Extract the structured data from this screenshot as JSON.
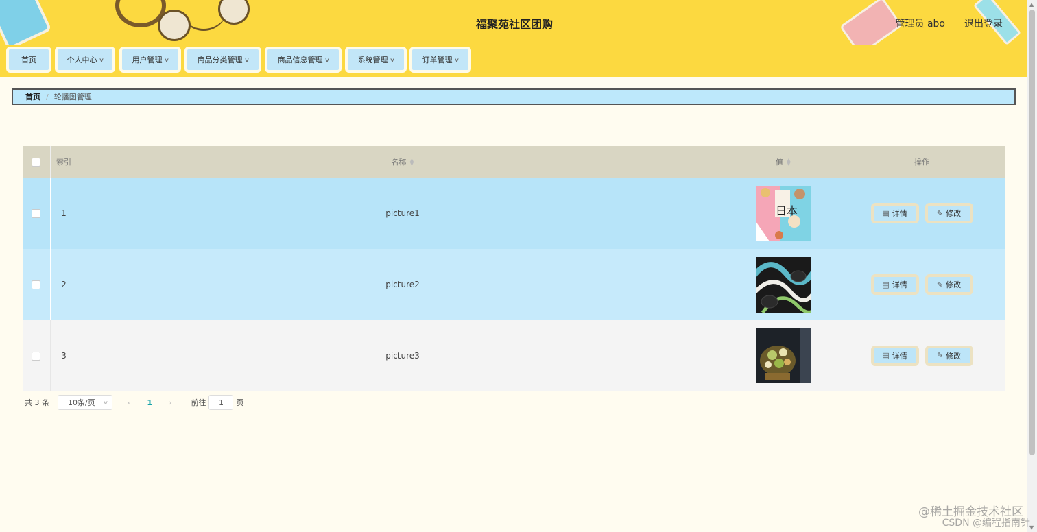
{
  "header": {
    "title": "福聚苑社区团购",
    "admin_label": "管理员 abo",
    "logout_label": "退出登录"
  },
  "nav": {
    "items": [
      {
        "label": "首页",
        "has_dropdown": false
      },
      {
        "label": "个人中心",
        "has_dropdown": true
      },
      {
        "label": "用户管理",
        "has_dropdown": true
      },
      {
        "label": "商品分类管理",
        "has_dropdown": true
      },
      {
        "label": "商品信息管理",
        "has_dropdown": true
      },
      {
        "label": "系统管理",
        "has_dropdown": true
      },
      {
        "label": "订单管理",
        "has_dropdown": true
      }
    ]
  },
  "breadcrumb": {
    "home": "首页",
    "separator": "/",
    "current": "轮播图管理"
  },
  "table": {
    "headers": {
      "index": "索引",
      "name": "名称",
      "value": "值",
      "actions": "操作"
    },
    "rows": [
      {
        "index": "1",
        "name": "picture1",
        "thumb": "colorful-food-collage"
      },
      {
        "index": "2",
        "name": "picture2",
        "thumb": "dark-plates-swirl"
      },
      {
        "index": "3",
        "name": "picture3",
        "thumb": "dark-food-dish"
      }
    ],
    "detail_label": "详情",
    "edit_label": "修改"
  },
  "pagination": {
    "total_text": "共 3 条",
    "page_size": "10条/页",
    "current_page": "1",
    "goto_label": "前往",
    "goto_value": "1",
    "page_unit": "页"
  },
  "watermark": {
    "line1": "@稀土掘金技术社区",
    "line2": "CSDN @编程指南针"
  },
  "colors": {
    "header_bg": "#fcd940",
    "nav_item_bg": "#c2e6f8",
    "row_highlight": "#b7e4f9",
    "table_header_bg": "#d9d6c3",
    "page_bg": "#fffcf0"
  }
}
